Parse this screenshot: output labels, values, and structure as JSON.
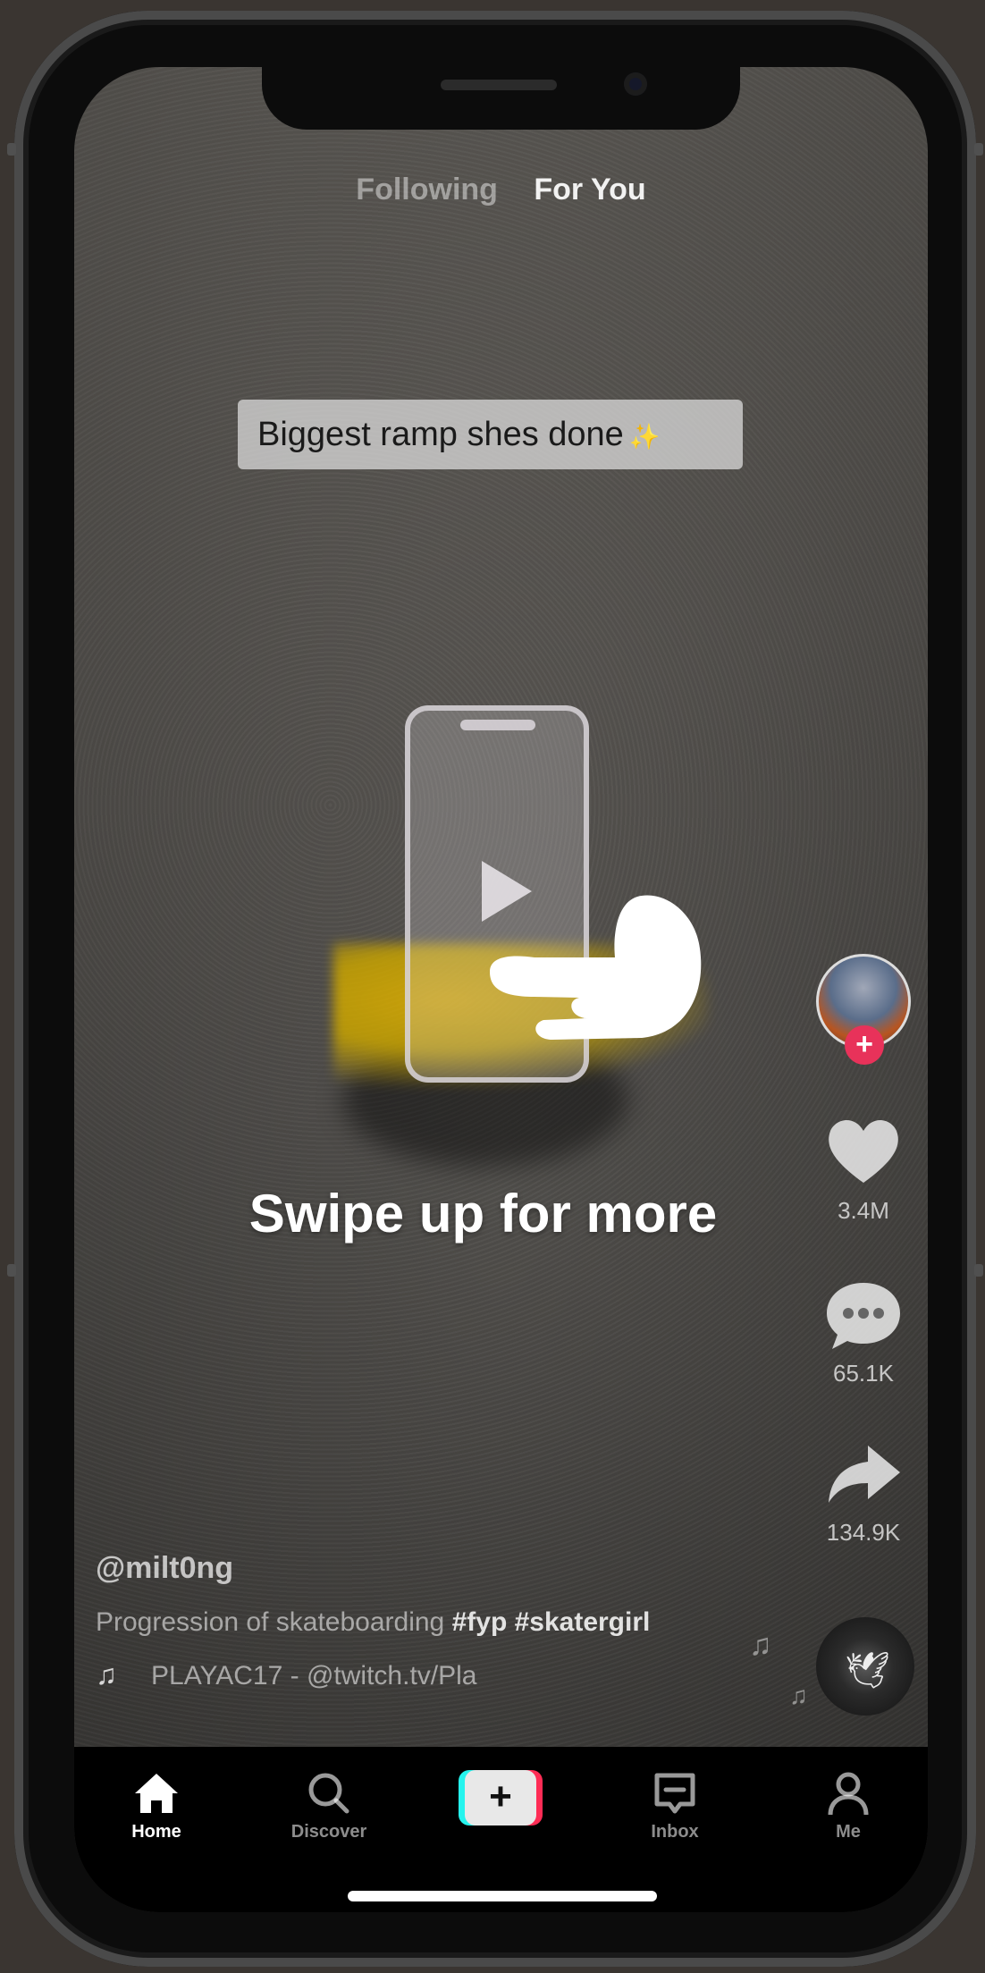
{
  "top_tabs": {
    "following": "Following",
    "for_you": "For You"
  },
  "video": {
    "caption_text": "Biggest ramp shes done",
    "caption_emoji": "✨"
  },
  "overlay": {
    "swipe_text": "Swipe up for more"
  },
  "rail": {
    "likes": "3.4M",
    "comments": "65.1K",
    "shares": "134.9K",
    "follow_symbol": "+"
  },
  "post": {
    "username": "@milt0ng",
    "description": "Progression of skateboarding",
    "hashtags": "#fyp #skatergirl",
    "music": "PLAYAC17 - @twitch.tv/Pla",
    "music_note": "♫"
  },
  "nav": {
    "home": "Home",
    "discover": "Discover",
    "create_symbol": "+",
    "inbox": "Inbox",
    "me": "Me"
  },
  "colors": {
    "accent_red": "#fe2c55",
    "accent_cyan": "#25f4ee",
    "follow_badge": "#e8325a"
  }
}
